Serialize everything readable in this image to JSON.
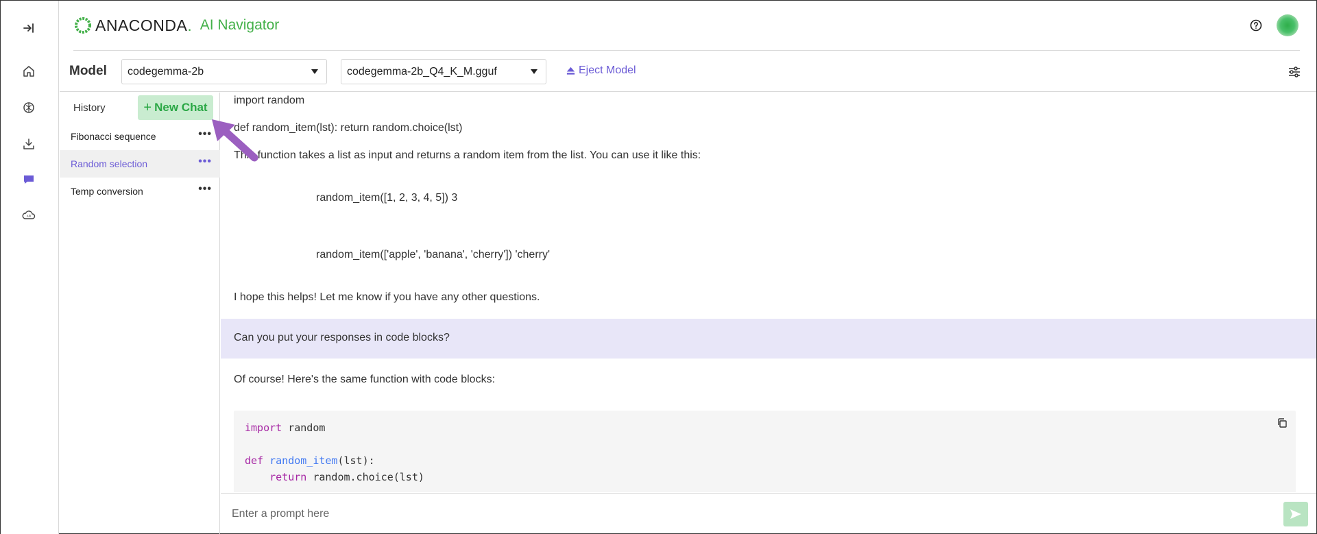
{
  "app": {
    "brand": "ANACONDA",
    "brand_dot": ".",
    "app_name": "AI Navigator"
  },
  "colors": {
    "brand_green": "#43b049",
    "accent_purple": "#6b5bd6",
    "user_bubble": "#e8e6f8",
    "annotation_arrow": "#9b5fc0"
  },
  "rail": {
    "icons": [
      "expand-sidebar-icon",
      "home-icon",
      "models-brain-icon",
      "download-icon",
      "chat-icon",
      "api-cloud-icon"
    ]
  },
  "header": {
    "help_icon": "question-circle-icon",
    "avatar": "user-avatar"
  },
  "modelbar": {
    "label": "Model",
    "model_select": "codegemma-2b",
    "file_select": "codegemma-2b_Q4_K_M.gguf",
    "eject_label": "Eject Model",
    "settings_icon": "sliders-icon"
  },
  "history": {
    "title": "History",
    "new_chat_label": "New Chat",
    "items": [
      {
        "label": "Fibonacci sequence",
        "active": false
      },
      {
        "label": "Random selection",
        "active": true
      },
      {
        "label": "Temp conversion",
        "active": false
      }
    ],
    "more_glyph": "•••"
  },
  "chat": {
    "lines": [
      "import random",
      "def random_item(lst): return random.choice(lst)",
      "This function takes a list as input and returns a random item from the list. You can use it like this:",
      "random_item([1, 2, 3, 4, 5]) 3",
      "random_item(['apple', 'banana', 'cherry']) 'cherry'",
      "I hope this helps! Let me know if you have any other questions."
    ],
    "user_message": "Can you put your responses in code blocks?",
    "reply_intro": "Of course! Here's the same function with code blocks:",
    "code": {
      "line1_kw": "import",
      "line1_rest": " random",
      "line2_kw": "def",
      "line2_fn": "random_item",
      "line2_rest": "(lst):",
      "line3_indent": "    ",
      "line3_kw": "return",
      "line3_rest": " random.choice(lst)"
    }
  },
  "prompt": {
    "placeholder": "Enter a prompt here",
    "value": ""
  }
}
